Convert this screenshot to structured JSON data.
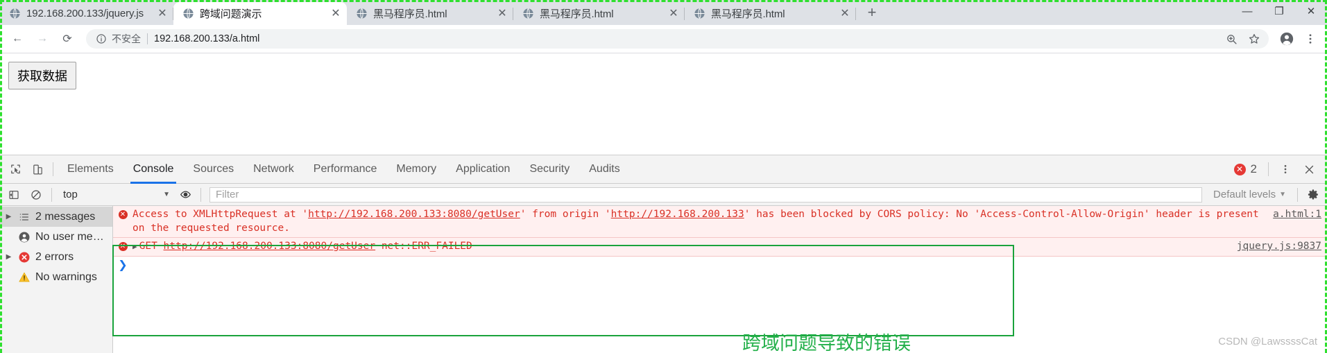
{
  "browser": {
    "tabs": [
      {
        "title": "192.168.200.133/jquery.js",
        "favicon": "globe-icon",
        "active": false
      },
      {
        "title": "跨域问题演示",
        "favicon": "globe-icon",
        "active": true
      },
      {
        "title": "黑马程序员.html",
        "favicon": "globe-icon",
        "active": false
      },
      {
        "title": "黑马程序员.html",
        "favicon": "globe-icon",
        "active": false
      },
      {
        "title": "黑马程序员.html",
        "favicon": "globe-icon",
        "active": false
      }
    ],
    "new_tab_label": "+",
    "window_controls": [
      {
        "name": "minimize",
        "glyph": "—"
      },
      {
        "name": "maximize",
        "glyph": "❐"
      },
      {
        "name": "close",
        "glyph": "✕"
      }
    ],
    "toolbar": {
      "back_label": "←",
      "forward_label": "→",
      "reload_label": "⟳",
      "security_text": "不安全",
      "url": "192.168.200.133/a.html",
      "zoom_icon": "zoom-in-icon",
      "bookmark_icon": "star-icon",
      "profile_icon": "avatar-icon",
      "menu_icon": "three-dot-menu-icon"
    }
  },
  "page": {
    "button_label": "获取数据"
  },
  "devtools": {
    "inspect_icon": "inspect-element-icon",
    "device_icon": "device-toolbar-icon",
    "tabs": [
      {
        "label": "Elements",
        "selected": false
      },
      {
        "label": "Console",
        "selected": true
      },
      {
        "label": "Sources",
        "selected": false
      },
      {
        "label": "Network",
        "selected": false
      },
      {
        "label": "Performance",
        "selected": false
      },
      {
        "label": "Memory",
        "selected": false
      },
      {
        "label": "Application",
        "selected": false
      },
      {
        "label": "Security",
        "selected": false
      },
      {
        "label": "Audits",
        "selected": false
      }
    ],
    "error_count": "2",
    "more_icon": "three-dot-menu-icon",
    "close_icon": "close-icon",
    "filterbar": {
      "sidebar_toggle_icon": "show-console-sidebar-icon",
      "clear_icon": "clear-console-icon",
      "context": "top",
      "eye_icon": "live-expression-icon",
      "filter_placeholder": "Filter",
      "levels": "Default levels",
      "settings_icon": "gear-icon"
    },
    "sidebar": [
      {
        "label": "2 messages",
        "icon": "list-icon",
        "expandable": true,
        "active": true
      },
      {
        "label": "No user me…",
        "icon": "user-icon",
        "expandable": false,
        "active": false
      },
      {
        "label": "2 errors",
        "icon": "error-icon",
        "expandable": true,
        "active": false
      },
      {
        "label": "No warnings",
        "icon": "warning-icon",
        "expandable": false,
        "active": false
      }
    ],
    "messages": [
      {
        "level": "error",
        "parts": [
          {
            "t": "Access to XMLHttpRequest at '",
            "link": false
          },
          {
            "t": "http://192.168.200.133:8080/getUser",
            "link": true
          },
          {
            "t": "' from origin '",
            "link": false
          },
          {
            "t": "http://192.168.200.133",
            "link": true
          },
          {
            "t": "' has been blocked by CORS policy: No 'Access-Control-Allow-Origin' header is present on the requested resource.",
            "link": false
          }
        ],
        "source": "a.html:1",
        "disclosure": false
      },
      {
        "level": "error",
        "parts": [
          {
            "t": "GET ",
            "link": false
          },
          {
            "t": "http://192.168.200.133:8080/getUser",
            "link": true
          },
          {
            "t": " net::ERR_FAILED",
            "link": false
          }
        ],
        "source": "jquery.js:9837",
        "disclosure": true
      }
    ],
    "prompt_symbol": "❯"
  },
  "annotation": {
    "text": "跨域问题导致的错误",
    "color": "#23b04a"
  },
  "watermark": "CSDN @LawssssCat"
}
